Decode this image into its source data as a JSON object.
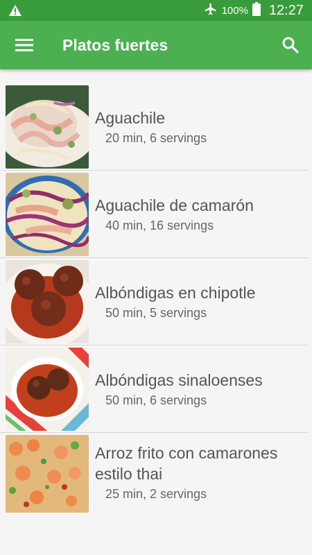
{
  "statusbar": {
    "battery": "100%",
    "time": "12:27"
  },
  "appbar": {
    "title": "Platos fuertes"
  },
  "recipes": [
    {
      "name": "Aguachile",
      "meta": "20 min, 6 servings"
    },
    {
      "name": "Aguachile de camarón",
      "meta": "40 min, 16 servings"
    },
    {
      "name": "Albóndigas en chipotle",
      "meta": "50 min, 5 servings"
    },
    {
      "name": "Albóndigas sinaloenses",
      "meta": "50 min, 6 servings"
    },
    {
      "name": "Arroz frito con camarones estilo thai",
      "meta": "25 min, 2 servings"
    }
  ],
  "colors": {
    "status_bar": "#389c3b",
    "app_bar": "#4caf50",
    "background": "#f5f5f5"
  }
}
